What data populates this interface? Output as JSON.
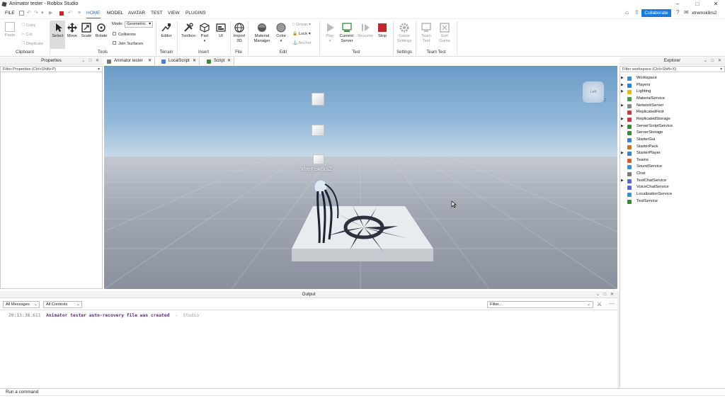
{
  "window": {
    "title": "Animator tester - Roblox Studio"
  },
  "menubar": {
    "items": [
      "FILE",
      "HOME",
      "MODEL",
      "AVATAR",
      "TEST",
      "VIEW",
      "PLUGINS"
    ],
    "active": "HOME",
    "collaborate_label": "Collaborate",
    "username": "xtremsk8rs2"
  },
  "ribbon": {
    "clipboard": {
      "paste": "Paste",
      "copy": "Copy",
      "cut": "Cut",
      "duplicate": "Duplicate",
      "group": "Clipboard"
    },
    "tools": {
      "select": "Select",
      "move": "Move",
      "scale": "Scale",
      "rotate": "Rotate",
      "mode_label": "Mode:",
      "mode_value": "Geometric",
      "collisions": "Collisions",
      "join_surfaces": "Join Surfaces",
      "group": "Tools"
    },
    "terrain": {
      "editor": "Editor",
      "group": "Terrain"
    },
    "insert": {
      "toolbox": "Toolbox",
      "part": "Part",
      "ui": "UI",
      "group": "Insert"
    },
    "file": {
      "import3d_line1": "Import",
      "import3d_line2": "3D",
      "group": "File"
    },
    "edit": {
      "material_line1": "Material",
      "material_line2": "Manager",
      "color": "Color",
      "group_btn": "Group",
      "lock": "Lock",
      "anchor": "Anchor",
      "group": "Edit"
    },
    "test": {
      "play": "Play",
      "current_line1": "Current:",
      "current_line2": "Server",
      "resume": "Resume",
      "stop": "Stop",
      "group": "Test"
    },
    "settings": {
      "game_line1": "Game",
      "game_line2": "Settings",
      "group": "Settings"
    },
    "teamtest": {
      "team_line1": "Team",
      "team_line2": "Test",
      "exit_line1": "Exit",
      "exit_line2": "Game",
      "group": "Team Test"
    }
  },
  "properties": {
    "title": "Properties",
    "filter": "Filter Properties (Ctrl+Shift+P)"
  },
  "tabs": [
    "Animator tester",
    "LocalScript",
    "Script"
  ],
  "viewport": {
    "player_name": "xtremsk8rs2",
    "view_cube_label": "Left",
    "axis_label": "Z"
  },
  "explorer": {
    "title": "Explorer",
    "filter": "Filter workspace (Ctrl+Shift+X)",
    "items": [
      {
        "label": "Workspace",
        "expandable": true,
        "color": "#3a8fd6"
      },
      {
        "label": "Players",
        "expandable": true,
        "color": "#2f7fd0"
      },
      {
        "label": "Lighting",
        "expandable": true,
        "color": "#e8b820"
      },
      {
        "label": "MaterialService",
        "expandable": false,
        "color": "#4a9a4a"
      },
      {
        "label": "NetworkServer",
        "expandable": true,
        "color": "#888888"
      },
      {
        "label": "ReplicatedFirst",
        "expandable": false,
        "color": "#c04040"
      },
      {
        "label": "ReplicatedStorage",
        "expandable": true,
        "color": "#c04040"
      },
      {
        "label": "ServerScriptService",
        "expandable": true,
        "color": "#3a8a3a"
      },
      {
        "label": "ServerStorage",
        "expandable": false,
        "color": "#3a8a3a"
      },
      {
        "label": "StarterGui",
        "expandable": false,
        "color": "#3a7fd0"
      },
      {
        "label": "StarterPack",
        "expandable": false,
        "color": "#b87a30"
      },
      {
        "label": "StarterPlayer",
        "expandable": true,
        "color": "#3a7fd0"
      },
      {
        "label": "Teams",
        "expandable": false,
        "color": "#d06030"
      },
      {
        "label": "SoundService",
        "expandable": false,
        "color": "#3a8fd6"
      },
      {
        "label": "Chat",
        "expandable": false,
        "color": "#7a7a7a"
      },
      {
        "label": "TextChatService",
        "expandable": true,
        "color": "#5a6ad0"
      },
      {
        "label": "VoiceChatService",
        "expandable": false,
        "color": "#5a6ad0"
      },
      {
        "label": "LocalizationService",
        "expandable": false,
        "color": "#3a8fd6"
      },
      {
        "label": "TestService",
        "expandable": false,
        "color": "#3a8a3a"
      }
    ]
  },
  "output": {
    "title": "Output",
    "messages_filter": "All Messages",
    "contexts_filter": "All Contexts",
    "filter_placeholder": "Filter...",
    "log": [
      {
        "time": "20:13:38.611",
        "text": "Animator tester auto-recovery file was created",
        "source": "Studio"
      }
    ]
  },
  "command_bar": {
    "placeholder": "Run a command"
  }
}
